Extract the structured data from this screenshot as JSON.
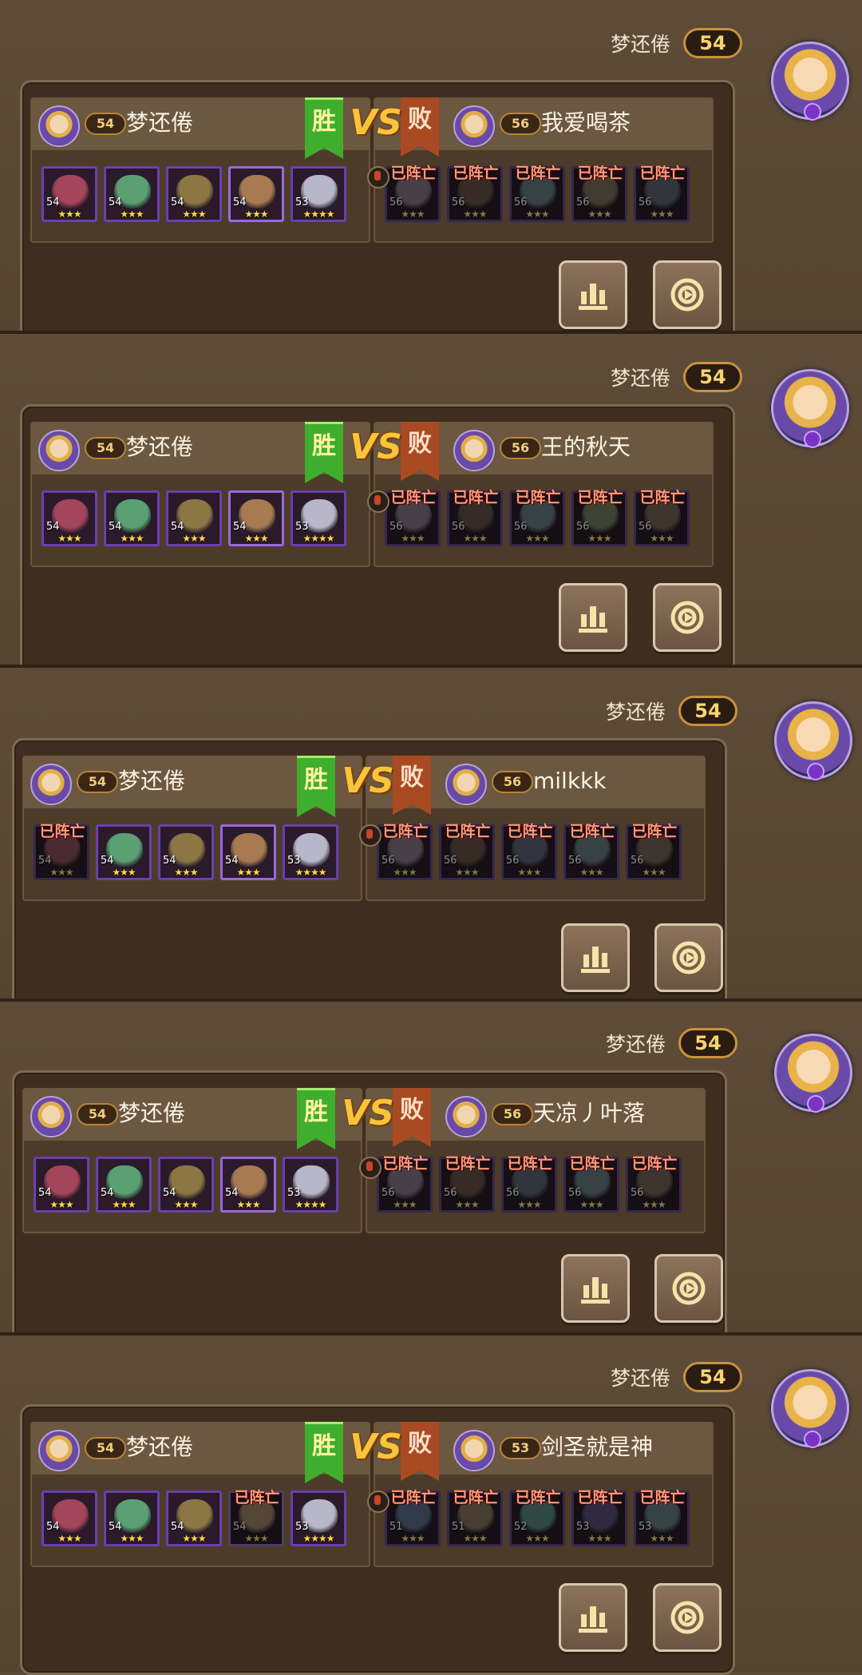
{
  "messages": [
    {
      "sender": "梦还倦",
      "sender_level": "54",
      "left": {
        "name": "梦还倦",
        "level": "54",
        "result": "胜",
        "heroes": [
          {
            "lv": "54",
            "stars": "★★★",
            "dead": false,
            "tone": "#a3455b"
          },
          {
            "lv": "54",
            "stars": "★★★",
            "dead": false,
            "tone": "#5aa073"
          },
          {
            "lv": "54",
            "stars": "★★★",
            "dead": false,
            "tone": "#8b7644"
          },
          {
            "lv": "54",
            "stars": "★★★",
            "dead": false,
            "tone": "#a87a52"
          },
          {
            "lv": "53",
            "stars": "★★★★",
            "dead": false,
            "tone": "#b8b7c9"
          }
        ]
      },
      "right": {
        "name": "我爱喝茶",
        "level": "56",
        "result": "败",
        "heroes": [
          {
            "lv": "56",
            "stars": "★★★",
            "dead": true,
            "tone": "#8f6e8c"
          },
          {
            "lv": "56",
            "stars": "★★★",
            "dead": true,
            "tone": "#6c4e3a"
          },
          {
            "lv": "56",
            "stars": "★★★",
            "dead": true,
            "tone": "#5a7a88"
          },
          {
            "lv": "56",
            "stars": "★★★",
            "dead": true,
            "tone": "#7f6a4b"
          },
          {
            "lv": "56",
            "stars": "★★★",
            "dead": true,
            "tone": "#56617a"
          }
        ]
      }
    },
    {
      "sender": "梦还倦",
      "sender_level": "54",
      "left": {
        "name": "梦还倦",
        "level": "54",
        "result": "胜",
        "heroes": [
          {
            "lv": "54",
            "stars": "★★★",
            "dead": false,
            "tone": "#a3455b"
          },
          {
            "lv": "54",
            "stars": "★★★",
            "dead": false,
            "tone": "#5aa073"
          },
          {
            "lv": "54",
            "stars": "★★★",
            "dead": false,
            "tone": "#8b7644"
          },
          {
            "lv": "54",
            "stars": "★★★",
            "dead": false,
            "tone": "#a87a52"
          },
          {
            "lv": "53",
            "stars": "★★★★",
            "dead": false,
            "tone": "#b8b7c9"
          }
        ]
      },
      "right": {
        "name": "王的秋天",
        "level": "56",
        "result": "败",
        "heroes": [
          {
            "lv": "56",
            "stars": "★★★",
            "dead": true,
            "tone": "#8f6e8c"
          },
          {
            "lv": "56",
            "stars": "★★★",
            "dead": true,
            "tone": "#6c4e3a"
          },
          {
            "lv": "56",
            "stars": "★★★",
            "dead": true,
            "tone": "#5a7a88"
          },
          {
            "lv": "56",
            "stars": "★★★",
            "dead": true,
            "tone": "#6d7a4b"
          },
          {
            "lv": "56",
            "stars": "★★★",
            "dead": true,
            "tone": "#7a5e4a"
          }
        ]
      }
    },
    {
      "sender": "梦还倦",
      "sender_level": "54",
      "left": {
        "name": "梦还倦",
        "level": "54",
        "result": "胜",
        "heroes": [
          {
            "lv": "54",
            "stars": "★★★",
            "dead": true,
            "tone": "#a3455b"
          },
          {
            "lv": "54",
            "stars": "★★★",
            "dead": false,
            "tone": "#5aa073"
          },
          {
            "lv": "54",
            "stars": "★★★",
            "dead": false,
            "tone": "#8b7644"
          },
          {
            "lv": "54",
            "stars": "★★★",
            "dead": false,
            "tone": "#a87a52"
          },
          {
            "lv": "53",
            "stars": "★★★★",
            "dead": false,
            "tone": "#b8b7c9"
          }
        ]
      },
      "right": {
        "name": "milkkk",
        "level": "56",
        "result": "败",
        "heroes": [
          {
            "lv": "56",
            "stars": "★★★",
            "dead": true,
            "tone": "#8f6e8c"
          },
          {
            "lv": "56",
            "stars": "★★★",
            "dead": true,
            "tone": "#6c4e3a"
          },
          {
            "lv": "56",
            "stars": "★★★",
            "dead": true,
            "tone": "#56617a"
          },
          {
            "lv": "56",
            "stars": "★★★",
            "dead": true,
            "tone": "#5a7a88"
          },
          {
            "lv": "56",
            "stars": "★★★",
            "dead": true,
            "tone": "#7a5e4a"
          }
        ]
      }
    },
    {
      "sender": "梦还倦",
      "sender_level": "54",
      "left": {
        "name": "梦还倦",
        "level": "54",
        "result": "胜",
        "heroes": [
          {
            "lv": "54",
            "stars": "★★★",
            "dead": false,
            "tone": "#a3455b"
          },
          {
            "lv": "54",
            "stars": "★★★",
            "dead": false,
            "tone": "#5aa073"
          },
          {
            "lv": "54",
            "stars": "★★★",
            "dead": false,
            "tone": "#8b7644"
          },
          {
            "lv": "54",
            "stars": "★★★",
            "dead": false,
            "tone": "#a87a52"
          },
          {
            "lv": "53",
            "stars": "★★★★",
            "dead": false,
            "tone": "#b8b7c9"
          }
        ]
      },
      "right": {
        "name": "天凉丿叶落",
        "level": "56",
        "result": "败",
        "heroes": [
          {
            "lv": "56",
            "stars": "★★★",
            "dead": true,
            "tone": "#8f6e8c"
          },
          {
            "lv": "56",
            "stars": "★★★",
            "dead": true,
            "tone": "#6c4e3a"
          },
          {
            "lv": "56",
            "stars": "★★★",
            "dead": true,
            "tone": "#56617a"
          },
          {
            "lv": "56",
            "stars": "★★★",
            "dead": true,
            "tone": "#5a7a88"
          },
          {
            "lv": "56",
            "stars": "★★★",
            "dead": true,
            "tone": "#7a5e4a"
          }
        ]
      }
    },
    {
      "sender": "梦还倦",
      "sender_level": "54",
      "left": {
        "name": "梦还倦",
        "level": "54",
        "result": "胜",
        "heroes": [
          {
            "lv": "54",
            "stars": "★★★",
            "dead": false,
            "tone": "#a3455b"
          },
          {
            "lv": "54",
            "stars": "★★★",
            "dead": false,
            "tone": "#5aa073"
          },
          {
            "lv": "54",
            "stars": "★★★",
            "dead": false,
            "tone": "#8b7644"
          },
          {
            "lv": "54",
            "stars": "★★★",
            "dead": true,
            "tone": "#a87a52"
          },
          {
            "lv": "53",
            "stars": "★★★★",
            "dead": false,
            "tone": "#b8b7c9"
          }
        ]
      },
      "right": {
        "name": "剑圣就是神",
        "level": "53",
        "result": "败",
        "heroes": [
          {
            "lv": "51",
            "stars": "★★★",
            "dead": true,
            "tone": "#4e6a9a"
          },
          {
            "lv": "51",
            "stars": "★★★",
            "dead": true,
            "tone": "#8a7048"
          },
          {
            "lv": "52",
            "stars": "★★★",
            "dead": true,
            "tone": "#3f8a78"
          },
          {
            "lv": "53",
            "stars": "★★★",
            "dead": true,
            "tone": "#5a4a8a"
          },
          {
            "lv": "53",
            "stars": "★★★",
            "dead": true,
            "tone": "#5a7a88"
          }
        ]
      }
    }
  ],
  "vs_label": "VS",
  "dead_label": "已阵亡",
  "icons": {
    "stats": "bar-chart-icon",
    "replay": "replay-icon",
    "medal": "medal-icon"
  },
  "colors": {
    "bg": "#5c4a36",
    "bubble": "#3f2e1f",
    "win": "#3fae2d",
    "lose": "#a94a22",
    "level_gold": "#f7d472"
  }
}
